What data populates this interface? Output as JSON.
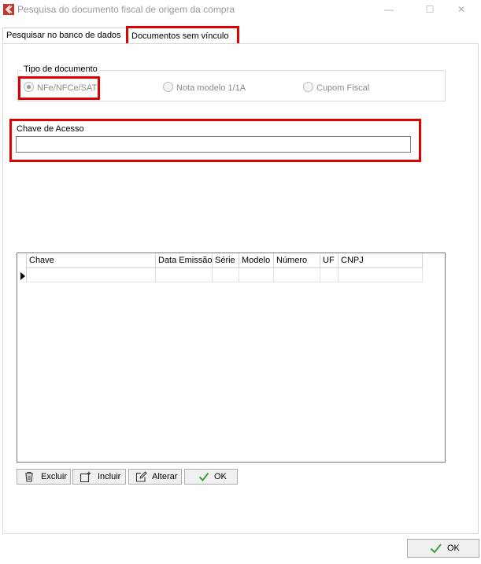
{
  "window": {
    "title": "Pesquisa do documento fiscal de origem da compra",
    "controls": {
      "minimize": "—",
      "maximize": "☐",
      "close": "✕"
    }
  },
  "tabs": [
    {
      "label": "Pesquisar no banco de dados",
      "selected": false
    },
    {
      "label": "Documentos sem vínculo",
      "selected": true
    }
  ],
  "tipo_documento": {
    "legend": "Tipo de documento",
    "options": [
      {
        "label": "NFe/NFCe/SAT",
        "selected": true
      },
      {
        "label": "Nota modelo 1/1A",
        "selected": false
      },
      {
        "label": "Cupom Fiscal",
        "selected": false
      }
    ]
  },
  "chave_acesso": {
    "label": "Chave de Acesso",
    "value": ""
  },
  "grid": {
    "columns": [
      "Chave",
      "Data Emissão",
      "Série",
      "Modelo",
      "Número",
      "UF",
      "CNPJ"
    ],
    "rows": [
      [
        "",
        "",
        "",
        "",
        "",
        "",
        ""
      ]
    ]
  },
  "grid_buttons": {
    "excluir": "Excluir",
    "incluir": "Incluir",
    "alterar": "Alterar",
    "ok": "OK"
  },
  "footer": {
    "ok": "OK"
  },
  "colors": {
    "highlight": "#e00000",
    "ok_check": "#3aa23a",
    "app_icon": "#c0392b"
  }
}
